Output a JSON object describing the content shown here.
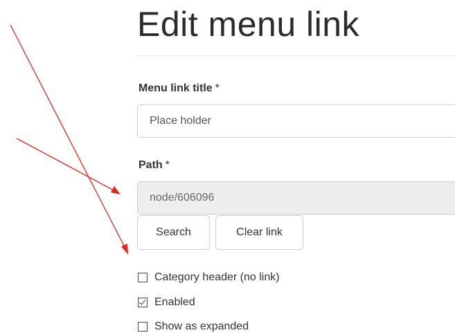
{
  "page": {
    "title": "Edit menu link"
  },
  "form": {
    "menu_link_title": {
      "label": "Menu link title",
      "required_marker": "*",
      "value": "Place holder"
    },
    "path": {
      "label": "Path",
      "required_marker": "*",
      "value": "node/606096"
    },
    "buttons": {
      "search": "Search",
      "clear_link": "Clear link"
    },
    "checkboxes": [
      {
        "label": "Category header (no link)",
        "checked": false
      },
      {
        "label": "Enabled",
        "checked": true
      },
      {
        "label": "Show as expanded",
        "checked": false
      }
    ]
  },
  "annotation": {
    "arrow_color": "#e8261c"
  }
}
